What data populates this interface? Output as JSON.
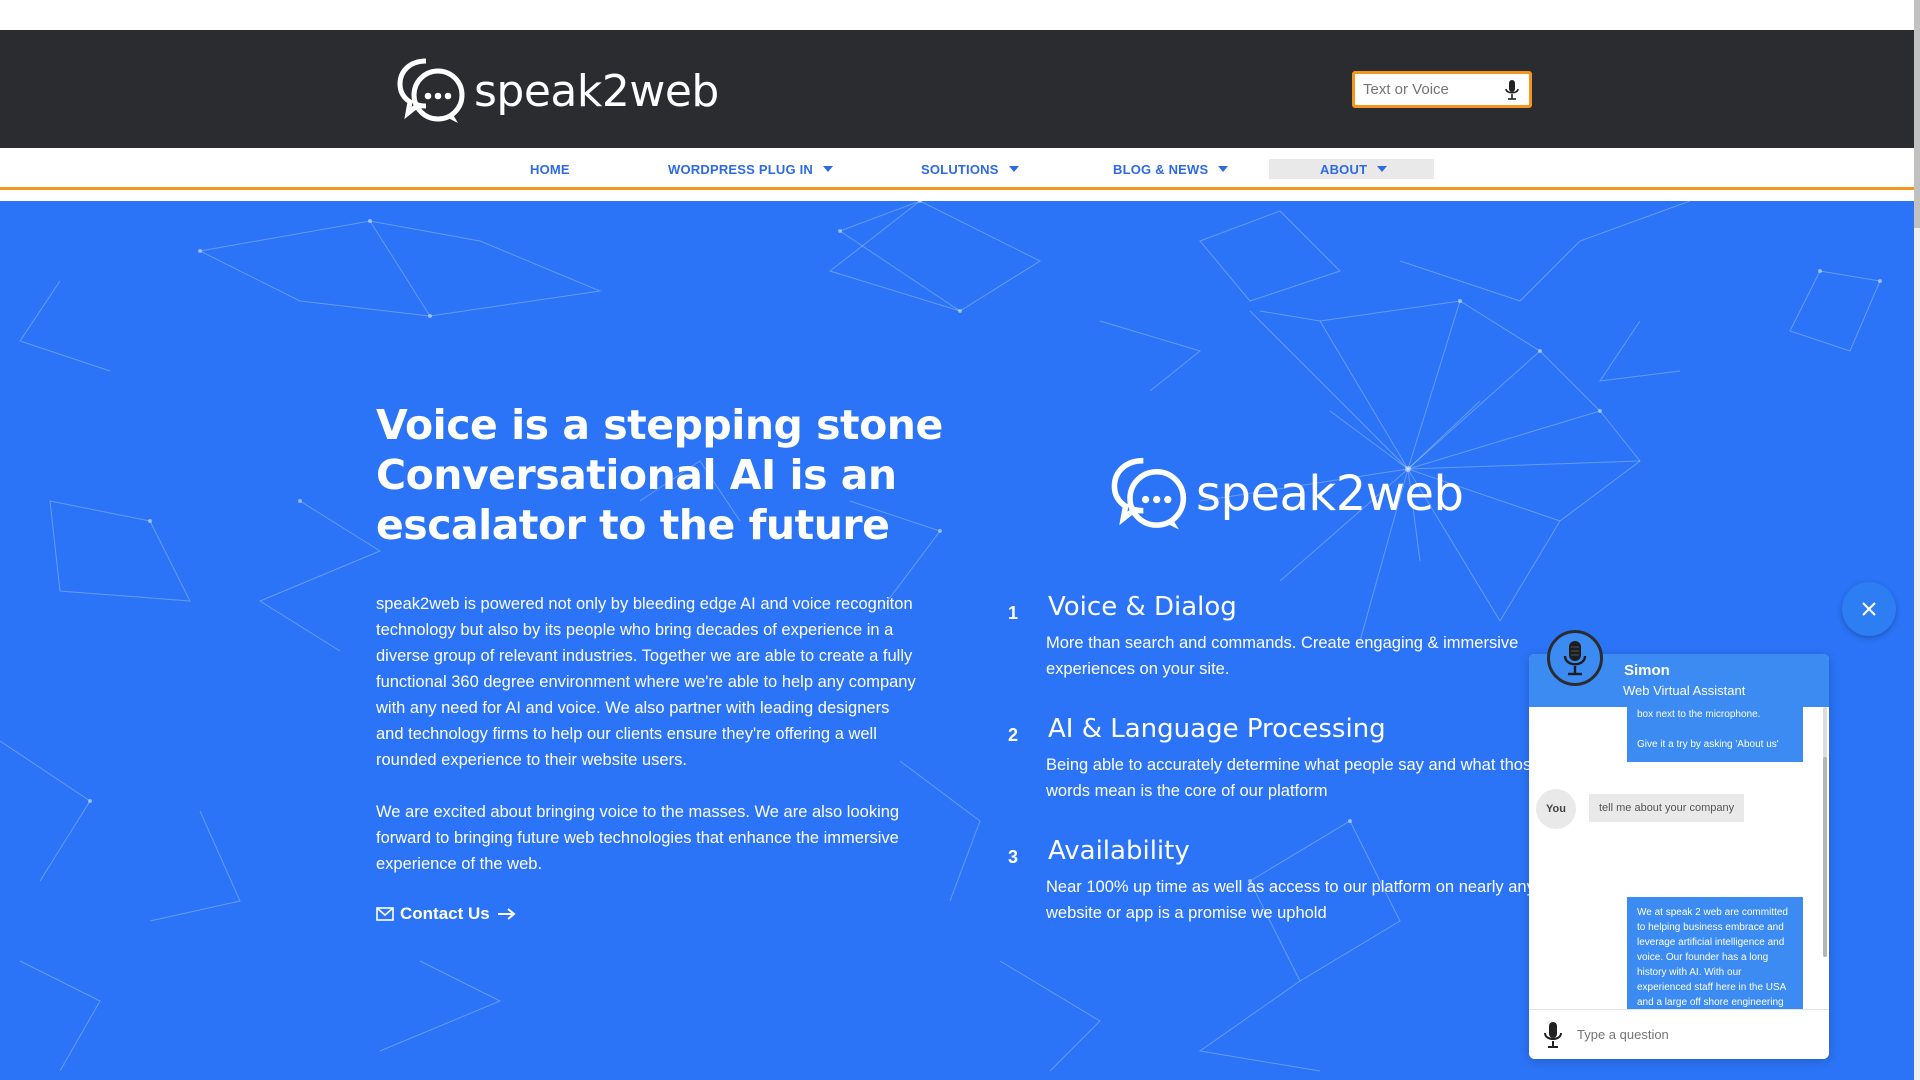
{
  "brand": {
    "name": "speak2web"
  },
  "search": {
    "placeholder": "Text or Voice"
  },
  "nav": {
    "items": [
      {
        "label": "HOME",
        "has_dropdown": false
      },
      {
        "label": "WORDPRESS PLUG IN",
        "has_dropdown": true
      },
      {
        "label": "SOLUTIONS",
        "has_dropdown": true
      },
      {
        "label": "BLOG & NEWS",
        "has_dropdown": true
      },
      {
        "label": "ABOUT",
        "has_dropdown": true,
        "active": true
      }
    ]
  },
  "hero": {
    "headline": [
      "Voice is a stepping stone",
      "Conversational AI is an",
      "escalator to the future"
    ],
    "paragraphs": [
      "speak2web is powered not only by bleeding edge AI and voice recogniton technology but also by its people who bring decades of experience in a diverse group of relevant industries. Together we are able to create a fully functional 360 degree environment where we're able to help any company with any need for AI and voice. We also partner with leading designers and technology firms to help our clients ensure they're offering a well rounded experience to their website users.",
      "We are excited about bringing voice to the masses. We are also looking forward to bringing future web technologies that enhance the immersive experience of the web."
    ],
    "contact_label": "Contact Us",
    "features": [
      {
        "number": "1",
        "title": "Voice & Dialog",
        "description": "More than search and commands. Create engaging & immersive experiences on your site."
      },
      {
        "number": "2",
        "title": "AI & Language Processing",
        "description": "Being able to accurately determine what people say and what those words mean is the core of our platform"
      },
      {
        "number": "3",
        "title": "Availability",
        "description": "Near 100% up time as well as access to our platform on nearly any website or app is a promise we uphold"
      }
    ]
  },
  "chat": {
    "agent_name": "Simon",
    "agent_role": "Web Virtual Assistant",
    "messages": [
      {
        "from": "bot",
        "lines": [
          "box next to the microphone.",
          "",
          "Give it a try by asking 'About us'"
        ]
      },
      {
        "from": "user",
        "author": "You",
        "text": "tell me about your company"
      },
      {
        "from": "bot",
        "text": "We at speak 2 web are committed to helping business embrace and leverage artificial intelligence and voice. Our founder has a long history with AI. With our experienced staff here in the USA and a large off shore engineering team we can take on projects of all sizes."
      }
    ],
    "input_placeholder": "Type a question"
  },
  "colors": {
    "header_bg": "#2b2c2f",
    "hero_bg": "#2b74f7",
    "accent_orange": "#f7941d",
    "nav_link": "#2d6ae3",
    "chat_blue": "#3b8bf2"
  },
  "icons": [
    "speak2web-logo-icon",
    "microphone-icon",
    "caret-down-icon",
    "envelope-icon",
    "arrow-right-icon",
    "close-icon"
  ]
}
